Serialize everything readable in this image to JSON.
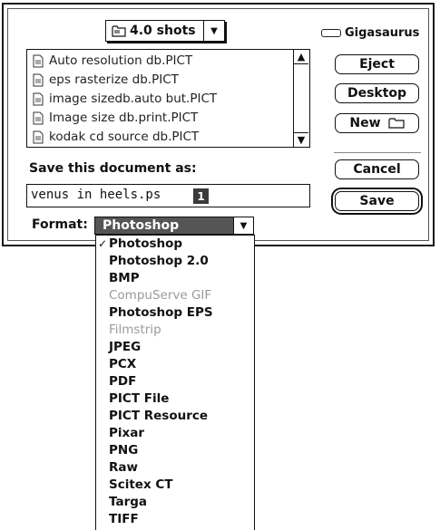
{
  "dialog": {
    "folder_popup": {
      "label": "4.0 shots",
      "icon": "folder-icon"
    },
    "volume": {
      "label": "Gigasaurus",
      "icon": "hard-disk-icon"
    },
    "file_list": [
      "Auto resolution db.PICT",
      "eps rasterize db.PICT",
      "image sizedb.auto but.PICT",
      "Image size db.print.PICT",
      "kodak cd source db.PICT"
    ],
    "buttons": {
      "eject": "Eject",
      "desktop": "Desktop",
      "new": "New",
      "cancel": "Cancel",
      "save": "Save"
    },
    "save_prompt": "Save this document as:",
    "filename": {
      "value": "venus in heels.ps"
    },
    "badge": "1",
    "format": {
      "label": "Format:",
      "selected": "Photoshop"
    }
  },
  "format_menu": {
    "items": [
      {
        "label": "Photoshop",
        "checked": true,
        "enabled": true
      },
      {
        "label": "Photoshop 2.0",
        "enabled": true
      },
      {
        "label": "BMP",
        "enabled": true
      },
      {
        "label": "CompuServe GIF",
        "enabled": false
      },
      {
        "label": "Photoshop EPS",
        "enabled": true
      },
      {
        "label": "Filmstrip",
        "enabled": false
      },
      {
        "label": "JPEG",
        "enabled": true
      },
      {
        "label": "PCX",
        "enabled": true
      },
      {
        "label": "PDF",
        "enabled": true
      },
      {
        "label": "PICT File",
        "enabled": true
      },
      {
        "label": "PICT Resource",
        "enabled": true
      },
      {
        "label": "Pixar",
        "enabled": true
      },
      {
        "label": "PNG",
        "enabled": true
      },
      {
        "label": "Raw",
        "enabled": true
      },
      {
        "label": "Scitex CT",
        "enabled": true
      },
      {
        "label": "Targa",
        "enabled": true
      },
      {
        "label": "TIFF",
        "enabled": true
      }
    ]
  }
}
